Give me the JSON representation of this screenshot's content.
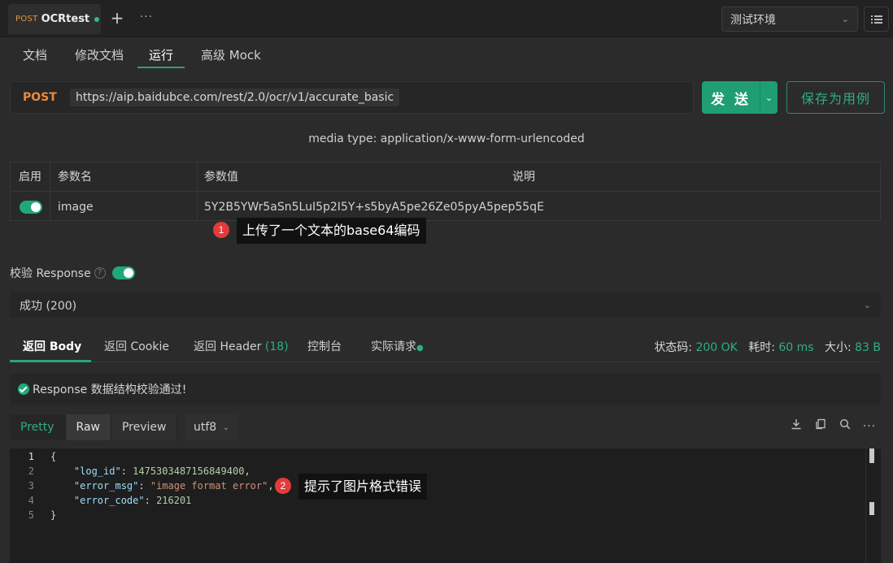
{
  "tab": {
    "method": "POST",
    "name": "OCRtest"
  },
  "tabbar": {
    "plus": "+",
    "more": "···"
  },
  "env": {
    "selected": "测试环境"
  },
  "subtabs": [
    "文档",
    "修改文档",
    "运行",
    "高级 Mock"
  ],
  "request": {
    "method": "POST",
    "url": "https://aip.baidubce.com/rest/2.0/ocr/v1/accurate_basic",
    "send_label": "发 送",
    "save_label": "保存为用例",
    "media_type": "media type: application/x-www-form-urlencoded"
  },
  "params": {
    "headers": [
      "启用",
      "参数名",
      "参数值",
      "说明"
    ],
    "rows": [
      {
        "enabled": true,
        "name": "image",
        "value": "5Y2B5YWr5aSn5LuI5p2I5Y+s5byA5pe26Ze05pyA5pep55qE",
        "desc": ""
      }
    ]
  },
  "annotations": [
    {
      "num": "1",
      "text": "上传了一个文本的base64编码"
    },
    {
      "num": "2",
      "text": "提示了图片格式错误"
    }
  ],
  "validation": {
    "label": "校验 Response",
    "help": "?",
    "enabled": true,
    "status": "成功 (200)"
  },
  "response_tabs": {
    "body": "返回 Body",
    "cookie": "返回 Cookie",
    "header": "返回 Header",
    "header_count": "(18)",
    "console": "控制台",
    "actual": "实际请求"
  },
  "metrics": {
    "status_label": "状态码:",
    "status_value": "200 OK",
    "time_label": "耗时:",
    "time_value": "60 ms",
    "size_label": "大小:",
    "size_value": "83 B"
  },
  "pass_message": "Response 数据结构校验通过!",
  "format": {
    "pretty": "Pretty",
    "raw": "Raw",
    "preview": "Preview",
    "encoding": "utf8"
  },
  "code": {
    "line_numbers": [
      "1",
      "2",
      "3",
      "4",
      "5"
    ],
    "log_id_key": "\"log_id\"",
    "log_id_value": "1475303487156849400",
    "error_msg_key": "\"error_msg\"",
    "error_msg_value": "\"image format error\"",
    "error_code_key": "\"error_code\"",
    "error_code_value": "216201"
  },
  "colors": {
    "accent": "#1e9e72",
    "method": "#ec8a3c",
    "badge": "#e23b3b"
  }
}
